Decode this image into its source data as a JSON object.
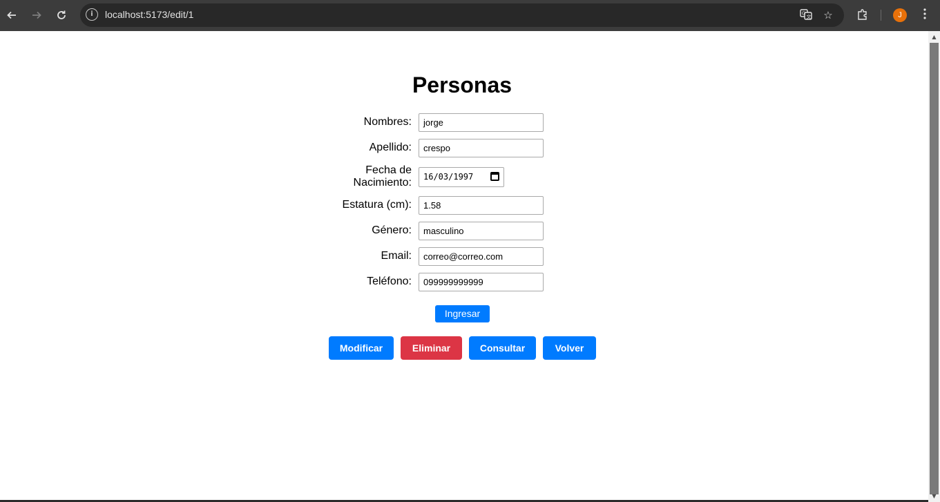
{
  "browser": {
    "url": "localhost:5173/edit/1",
    "profile_initial": "J",
    "icons": {
      "back": "arrow-left-icon",
      "forward": "arrow-right-icon",
      "reload": "reload-icon",
      "site_info": "info-icon",
      "translate": "translate-icon",
      "bookmark": "star-icon",
      "extensions": "puzzle-icon",
      "menu": "kebab-menu-icon"
    }
  },
  "page": {
    "title": "Personas",
    "form": {
      "fields": [
        {
          "label": "Nombres:",
          "value": "jorge"
        },
        {
          "label": "Apellido:",
          "value": "crespo"
        },
        {
          "label_line1": "Fecha de",
          "label_line2": "Nacimiento:",
          "value": "16/03/1997"
        },
        {
          "label": "Estatura (cm):",
          "value": "1.58"
        },
        {
          "label": "Género:",
          "value": "masculino"
        },
        {
          "label": "Email:",
          "value": "correo@correo.com"
        },
        {
          "label": "Teléfono:",
          "value": "099999999999"
        }
      ],
      "submit_label": "Ingresar"
    },
    "actions": {
      "modify": "Modificar",
      "delete": "Eliminar",
      "query": "Consultar",
      "back": "Volver"
    },
    "colors": {
      "primary": "#007bff",
      "danger": "#dc3545"
    }
  }
}
